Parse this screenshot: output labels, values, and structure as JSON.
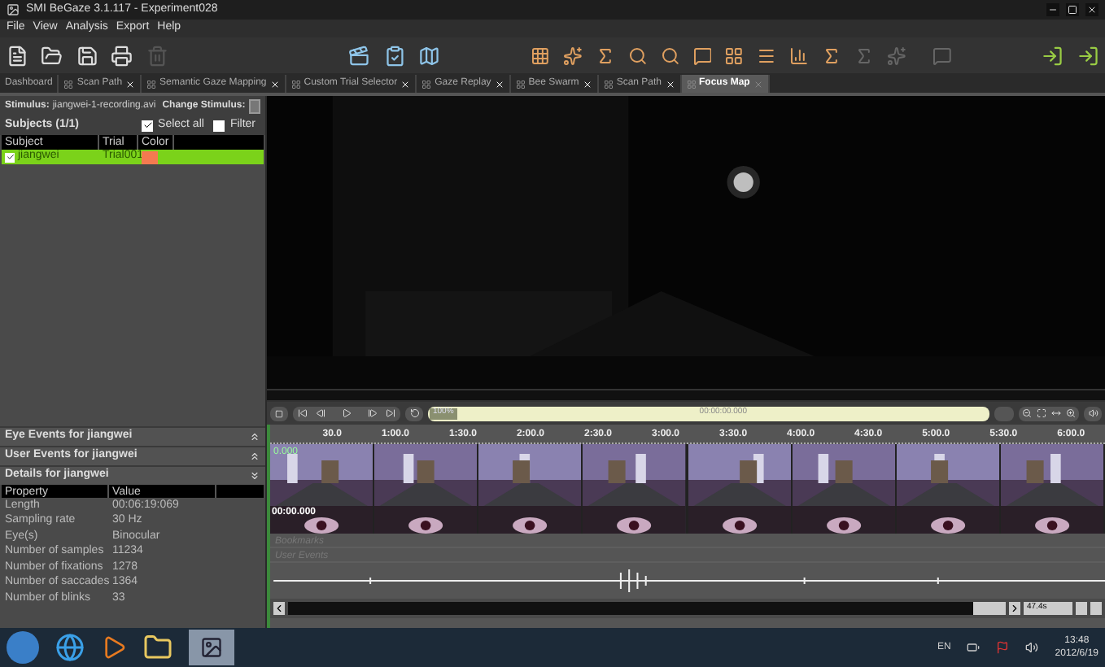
{
  "window": {
    "title": "SMI BeGaze 3.1.117 - Experiment028"
  },
  "menu": [
    "File",
    "View",
    "Analysis",
    "Export",
    "Help"
  ],
  "tabs": [
    {
      "label": "Dashboard",
      "selected": false
    },
    {
      "label": "Scan Path",
      "selected": false
    },
    {
      "label": "Semantic Gaze Mapping",
      "selected": false
    },
    {
      "label": "Custom Trial Selector",
      "selected": false
    },
    {
      "label": "Gaze Replay",
      "selected": false
    },
    {
      "label": "Bee Swarm",
      "selected": false
    },
    {
      "label": "Scan Path",
      "selected": false
    },
    {
      "label": "Focus Map",
      "selected": true
    }
  ],
  "stimulus": {
    "label": "Stimulus:",
    "value": "jiangwei-1-recording.avi",
    "change_label": "Change Stimulus:"
  },
  "subjects": {
    "title": "Subjects (1/1)",
    "select_all": {
      "label": "Select all",
      "checked": true
    },
    "filter": {
      "label": "Filter",
      "checked": false
    },
    "columns": [
      "Subject",
      "Trial",
      "Color"
    ],
    "rows": [
      {
        "subject": "jiangwei",
        "trial": "Trial001",
        "color": "#f47a50",
        "checked": true,
        "selected": true
      }
    ]
  },
  "sections": [
    {
      "title": "Eye Events for jiangwei",
      "expanded": false
    },
    {
      "title": "User Events for jiangwei",
      "expanded": false
    },
    {
      "title": "Details for jiangwei",
      "expanded": true
    }
  ],
  "details": {
    "columns": [
      "Property",
      "Value"
    ],
    "rows": [
      [
        "Length",
        "00:06:19:069"
      ],
      [
        "Sampling rate",
        "30 Hz"
      ],
      [
        "Eye(s)",
        "Binocular"
      ],
      [
        "Number of samples",
        "11234"
      ],
      [
        "Number of fixations",
        "1278"
      ],
      [
        "Number of saccades",
        "1364"
      ],
      [
        "Number of blinks",
        "33"
      ]
    ]
  },
  "player": {
    "zoom": "100%",
    "time": "00:00:00.000"
  },
  "timeline": {
    "ticks": [
      "30.0",
      "1:00.0",
      "1:30.0",
      "2:00.0",
      "2:30.0",
      "3:00.0",
      "3:30.0",
      "4:00.0",
      "4:30.0",
      "5:00.0",
      "5:30.0",
      "6:00.0"
    ],
    "start_value": "0.000",
    "start_time": "00:00.000",
    "tracks": [
      "Bookmarks",
      "User Events"
    ],
    "window": "47.4s"
  },
  "taskbar": {
    "language": "EN",
    "time": "13:48",
    "date": "2012/6/19"
  }
}
